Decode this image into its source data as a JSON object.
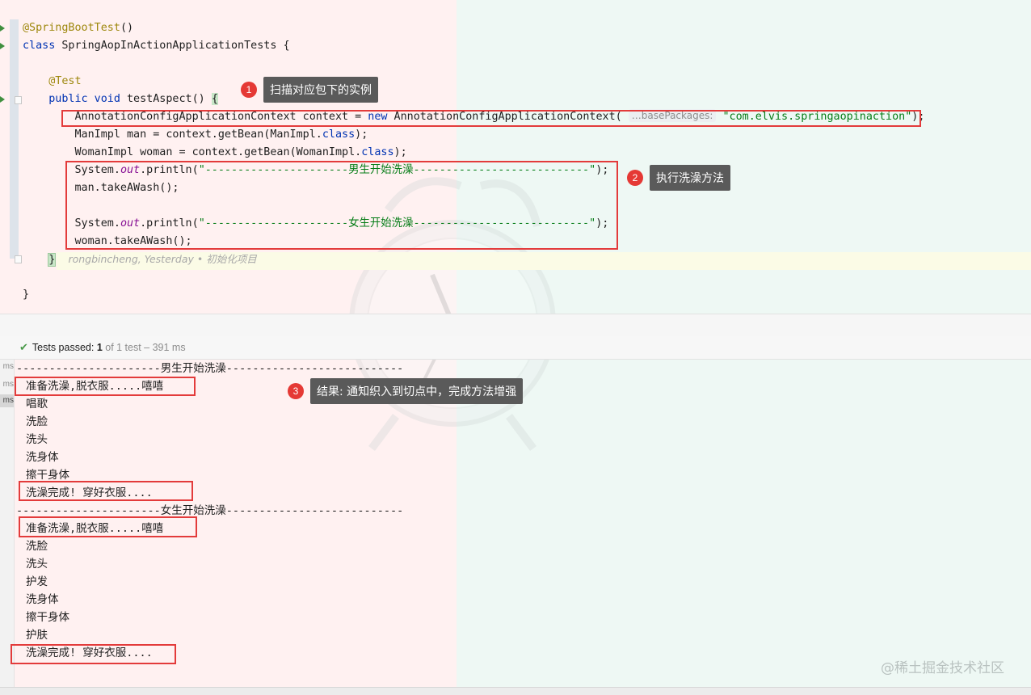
{
  "editor": {
    "lines": [
      {
        "name": "annotation-springboottest",
        "parts": [
          {
            "c": "ann",
            "t": "@SpringBootTest"
          },
          {
            "c": "",
            "t": "()"
          }
        ]
      },
      {
        "name": "class-declaration",
        "parts": [
          {
            "c": "kw",
            "t": "class"
          },
          {
            "c": "",
            "t": " SpringAopInActionApplicationTests {"
          }
        ]
      },
      {
        "name": "blank-line",
        "parts": []
      },
      {
        "name": "annotation-test",
        "parts": [
          {
            "c": "",
            "t": "    "
          },
          {
            "c": "ann",
            "t": "@Test"
          }
        ]
      },
      {
        "name": "method-signature",
        "parts": [
          {
            "c": "",
            "t": "    "
          },
          {
            "c": "kw",
            "t": "public void"
          },
          {
            "c": "",
            "t": " testAspect() "
          },
          {
            "c": "caret-brace",
            "t": "{"
          }
        ]
      },
      {
        "name": "context-line",
        "parts": [
          {
            "c": "",
            "t": "        AnnotationConfigApplicationContext context = "
          },
          {
            "c": "kw",
            "t": "new"
          },
          {
            "c": "",
            "t": " AnnotationConfigApplicationContext( "
          },
          {
            "c": "hint",
            "t": "…basePackages:"
          },
          {
            "c": "",
            "t": " "
          },
          {
            "c": "str",
            "t": "\"com.elvis.springaopinaction\""
          },
          {
            "c": "",
            "t": ");"
          }
        ]
      },
      {
        "name": "getbean-man-line",
        "parts": [
          {
            "c": "",
            "t": "        ManImpl man = context.getBean(ManImpl."
          },
          {
            "c": "kw",
            "t": "class"
          },
          {
            "c": "",
            "t": ");"
          }
        ]
      },
      {
        "name": "getbean-woman-line",
        "parts": [
          {
            "c": "",
            "t": "        WomanImpl woman = context.getBean(WomanImpl."
          },
          {
            "c": "kw",
            "t": "class"
          },
          {
            "c": "",
            "t": ");"
          }
        ]
      },
      {
        "name": "println-man-line",
        "parts": [
          {
            "c": "",
            "t": "        System."
          },
          {
            "c": "fld",
            "t": "out"
          },
          {
            "c": "",
            "t": ".println("
          },
          {
            "c": "str",
            "t": "\"----------------------男生开始洗澡---------------------------\""
          },
          {
            "c": "",
            "t": ");"
          }
        ]
      },
      {
        "name": "man-takeawash-line",
        "parts": [
          {
            "c": "",
            "t": "        man.takeAWash();"
          }
        ]
      },
      {
        "name": "blank-line",
        "parts": []
      },
      {
        "name": "println-woman-line",
        "parts": [
          {
            "c": "",
            "t": "        System."
          },
          {
            "c": "fld",
            "t": "out"
          },
          {
            "c": "",
            "t": ".println("
          },
          {
            "c": "str",
            "t": "\"----------------------女生开始洗澡---------------------------\""
          },
          {
            "c": "",
            "t": ");"
          }
        ]
      },
      {
        "name": "woman-takeawash-line",
        "parts": [
          {
            "c": "",
            "t": "        woman.takeAWash();"
          }
        ]
      },
      {
        "name": "method-close-line",
        "parts": [
          {
            "c": "",
            "t": "    "
          },
          {
            "c": "brace-hl",
            "t": "}"
          },
          {
            "c": "",
            "t": "  "
          },
          {
            "c": "blame",
            "t": "rongbincheng, Yesterday • 初始化项目"
          }
        ]
      },
      {
        "name": "blank-line",
        "parts": []
      },
      {
        "name": "class-close-line",
        "parts": [
          {
            "c": "",
            "t": "}"
          }
        ]
      }
    ]
  },
  "callouts": [
    {
      "num": "1",
      "text": "扫描对应包下的实例"
    },
    {
      "num": "2",
      "text": "执行洗澡方法"
    },
    {
      "num": "3",
      "text": "结果: 通知织入到切点中，完成方法增强"
    }
  ],
  "status": {
    "label": "Tests passed: ",
    "count": "1",
    "rest": " of 1 test – 391 ms"
  },
  "ms_labels": [
    "ms",
    "ms",
    "ms"
  ],
  "output": [
    "----------------------男生开始洗澡---------------------------",
    "准备洗澡,脱衣服.....嘻嘻",
    "唱歌",
    "洗脸",
    "洗头",
    "洗身体",
    "擦干身体",
    "洗澡完成! 穿好衣服....",
    "----------------------女生开始洗澡---------------------------",
    "准备洗澡,脱衣服.....嘻嘻",
    "洗脸",
    "洗头",
    "护发",
    "洗身体",
    "擦干身体",
    "护肤",
    "洗澡完成! 穿好衣服...."
  ],
  "watermark": "@稀土掘金技术社区",
  "colors": {
    "highlight_box": "#e33b3b",
    "badge": "#e53935",
    "callout_bg": "#5a5a5a",
    "keyword": "#0033b3",
    "string": "#067d17",
    "annotation": "#9e880d"
  }
}
